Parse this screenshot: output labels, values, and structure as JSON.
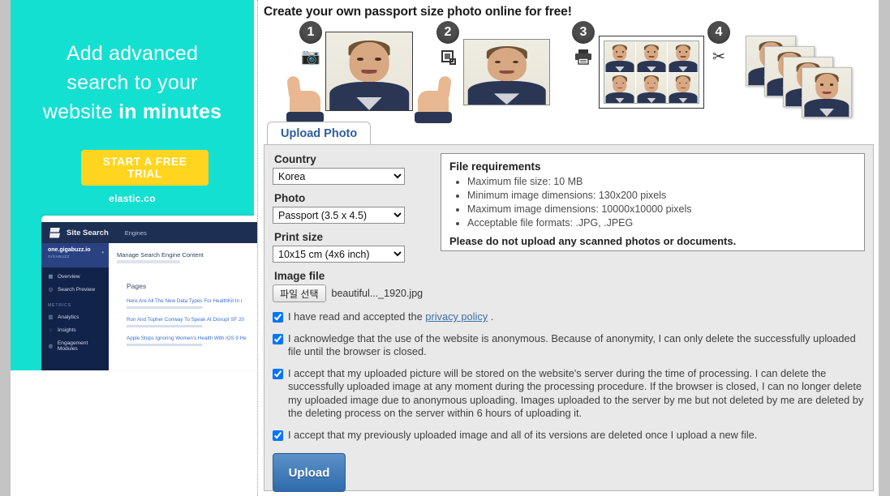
{
  "ad": {
    "headline_line1": "Add advanced",
    "headline_line2": "search to your",
    "headline_line3_plain": "website ",
    "headline_line3_bold": "in minutes",
    "cta_label": "START A FREE TRIAL",
    "domain": "elastic.co",
    "bg_color": "#14e0d2",
    "cta_color": "#ffd520",
    "screenshot": {
      "brand": "Site Search",
      "nav_item": "Engines",
      "account_name": "one.gigabuzz.io",
      "account_org": "GIGABUZZ",
      "menu_items": [
        {
          "label": "Overview",
          "icon": "grid-icon"
        },
        {
          "label": "Search Preview",
          "icon": "eye-icon"
        }
      ],
      "section_label": "METRICS",
      "metric_items": [
        {
          "label": "Analytics",
          "icon": "chart-icon"
        },
        {
          "label": "Insights",
          "icon": "bulb-icon"
        },
        {
          "label": "Engagement Modules",
          "icon": "modules-icon"
        }
      ],
      "content_title": "Manage Search Engine Content",
      "content_section": "Pages",
      "results": [
        "Here Are All The New Data Types For HealthKit In i",
        "Ron And Topher Conway To Speak At Disrupt SF 20",
        "Apple Stops Ignoring Women's Health With iOS 9 He"
      ]
    }
  },
  "main": {
    "page_title": "Create your own passport size photo online for free!",
    "steps": [
      {
        "number": "1",
        "icon": "camera-icon"
      },
      {
        "number": "2",
        "icon": "crop-icon"
      },
      {
        "number": "3",
        "icon": "printer-icon"
      },
      {
        "number": "4",
        "icon": "scissors-icon"
      }
    ],
    "tab": {
      "label": "Upload Photo"
    },
    "form": {
      "country_label": "Country",
      "country_value": "Korea",
      "country_options": [
        "Korea"
      ],
      "photo_label": "Photo",
      "photo_value": "Passport (3.5 x 4.5)",
      "photo_options": [
        "Passport (3.5 x 4.5)"
      ],
      "print_size_label": "Print size",
      "print_size_value": "10x15 cm (4x6 inch)",
      "print_size_options": [
        "10x15 cm (4x6 inch)"
      ],
      "image_file_label": "Image file",
      "file_button_label": "파일 선택",
      "file_name": "beautiful..._1920.jpg"
    },
    "requirements": {
      "title": "File requirements",
      "items": [
        "Maximum file size: 10 MB",
        "Minimum image dimensions: 130x200 pixels",
        "Maximum image dimensions: 10000x10000 pixels",
        "Acceptable file formats: .JPG, .JPEG"
      ],
      "note": "Please do not upload any scanned photos or documents."
    },
    "checkboxes": [
      {
        "checked": true,
        "text_before": "I have read and accepted the ",
        "link_text": "privacy policy",
        "text_after": " ."
      },
      {
        "checked": true,
        "text_before": "I acknowledge that the use of the website is anonymous. Because of anonymity, I can only delete the successfully uploaded file until the browser is closed.",
        "link_text": "",
        "text_after": ""
      },
      {
        "checked": true,
        "text_before": "I accept that my uploaded picture will be stored on the website's server during the time of processing. I can delete the successfully uploaded image at any moment during the processing procedure. If the browser is closed, I can no longer delete my uploaded image due to anonymous uploading. Images uploaded to the server by me but not deleted by me are deleted by the deleting process on the server within 6 hours of uploading it.",
        "link_text": "",
        "text_after": ""
      },
      {
        "checked": true,
        "text_before": "I accept that my previously uploaded image and all of its versions are deleted once I upload a new file.",
        "link_text": "",
        "text_after": ""
      }
    ],
    "upload_button_label": "Upload"
  }
}
